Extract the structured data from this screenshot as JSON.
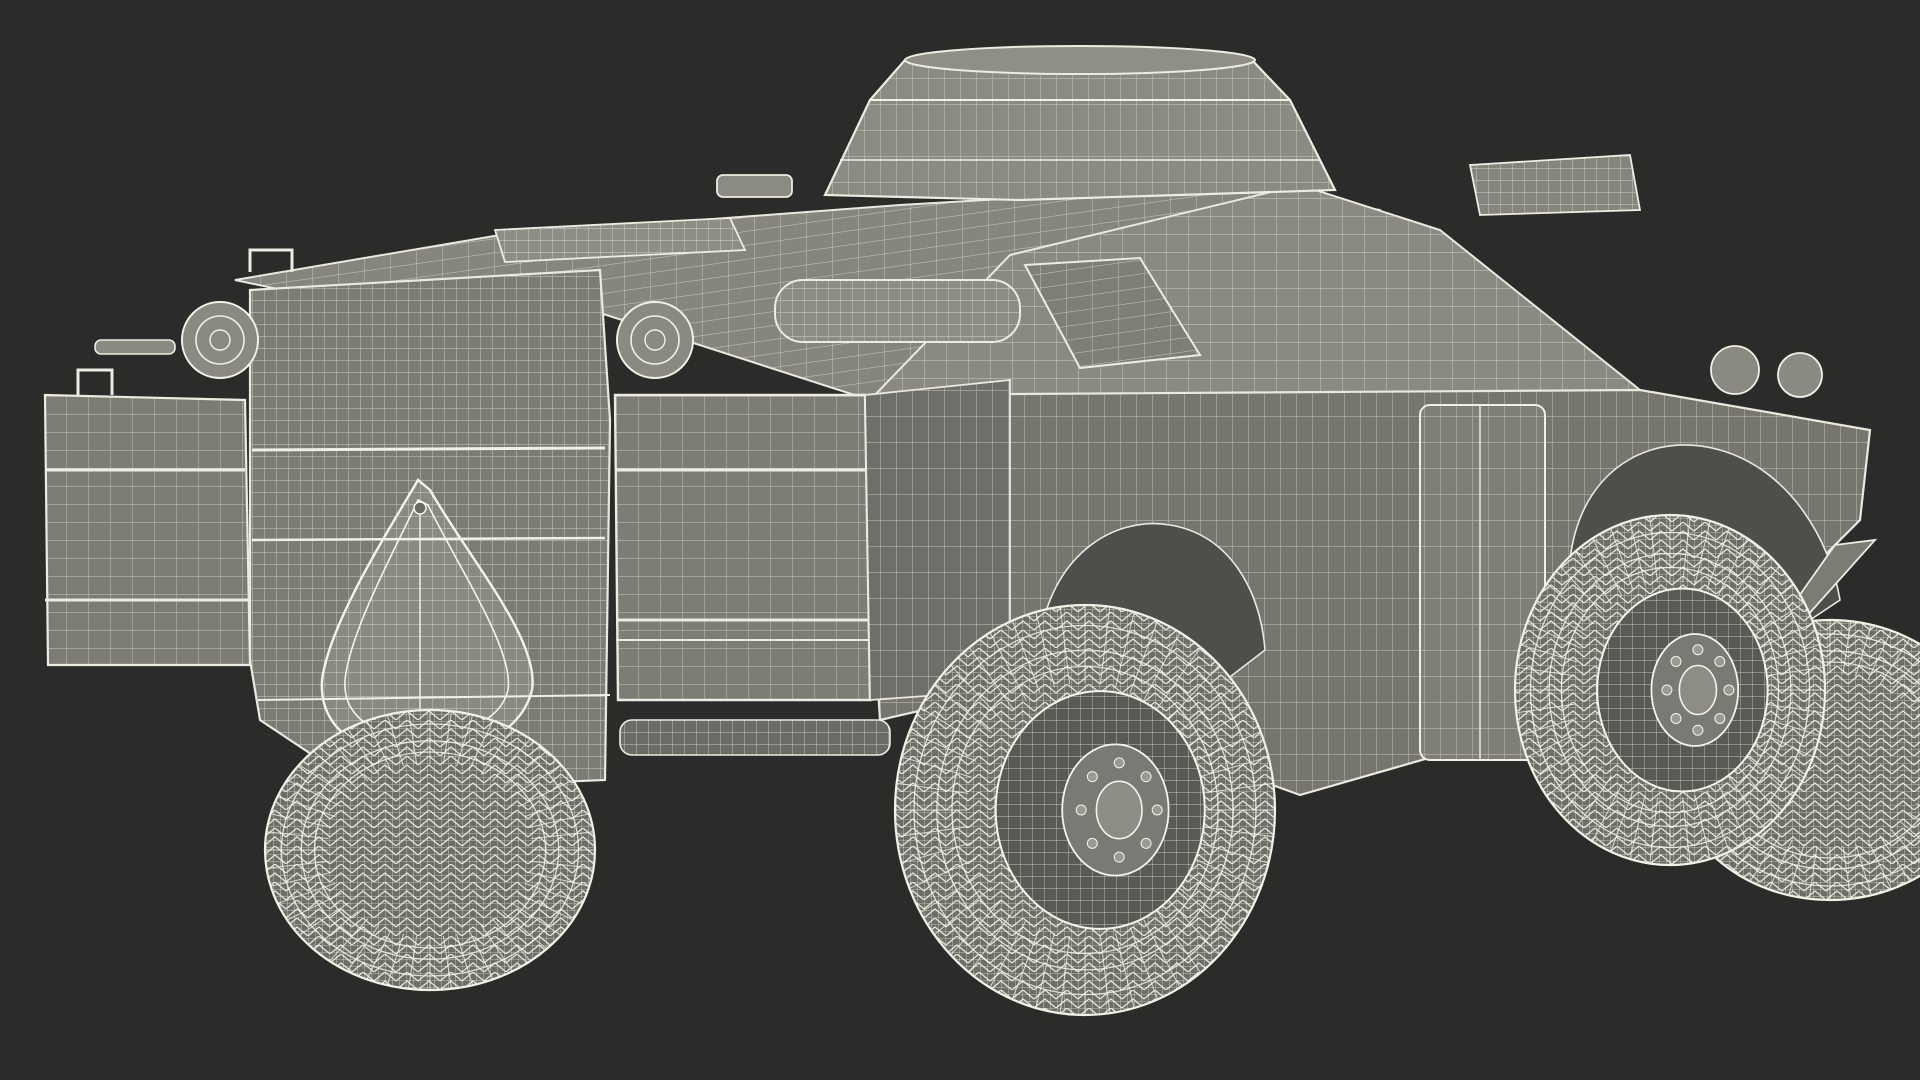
{
  "scene": {
    "subject": "armored-scout-car-wireframe",
    "view": "rear-three-quarter",
    "colors": {
      "background": "#2b2b2a",
      "surface_fill": "#7a7a74",
      "surface_fill_dark": "#5f5f5a",
      "surface_fill_light": "#8c8c85",
      "wire": "#e9e9df",
      "wire_dim": "#c9c9bf",
      "tire_fill": "#6e6e68",
      "hub_fill": "#5a5a55"
    }
  }
}
